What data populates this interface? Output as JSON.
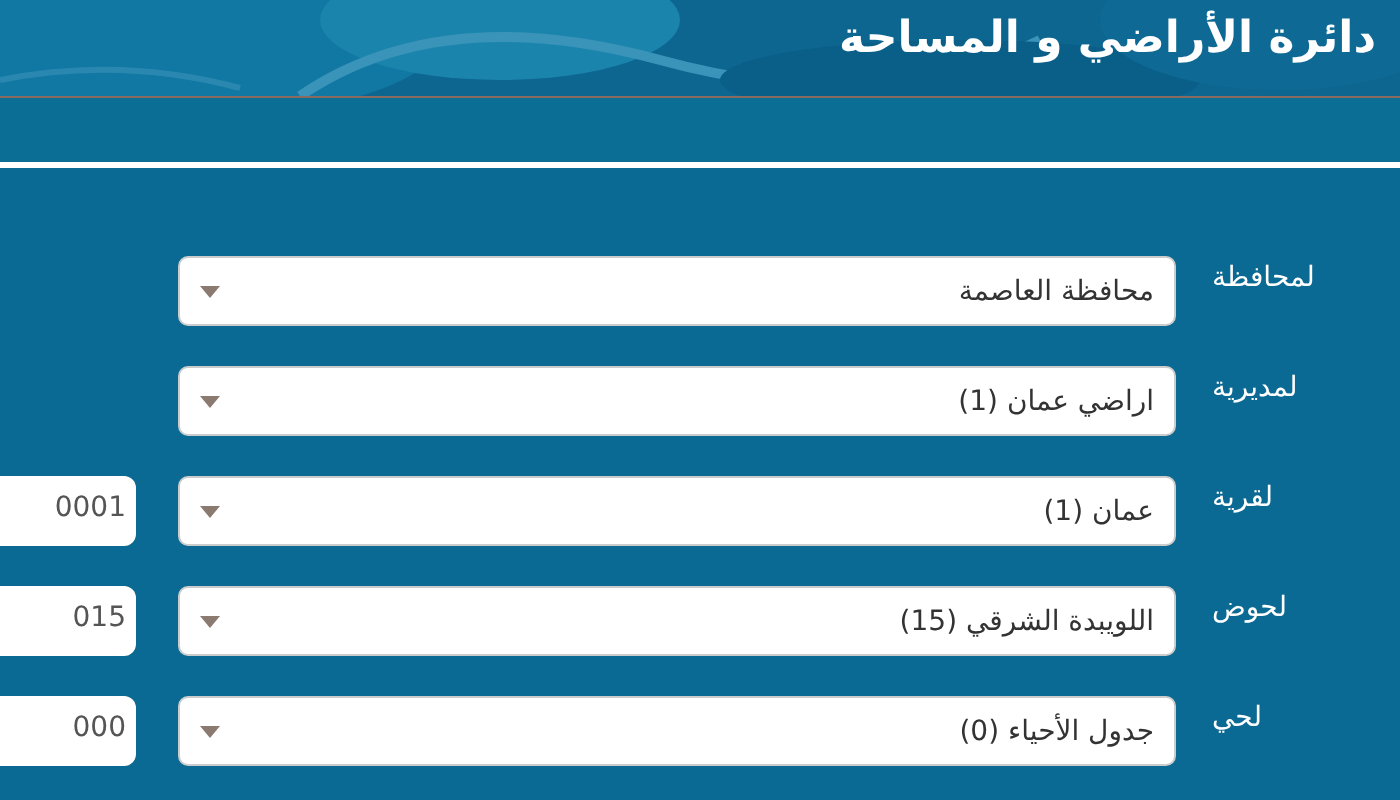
{
  "header": {
    "title": "دائرة الأراضي و المساحة"
  },
  "fields": [
    {
      "label": "لمحافظة",
      "value": "محافظة العاصمة"
    },
    {
      "label": "لمديرية",
      "value": "اراضي عمان (1)"
    },
    {
      "label": "لقرية",
      "value": "عمان (1)",
      "code": "0001"
    },
    {
      "label": "لحوض",
      "value": "اللويبدة الشرقي (15)",
      "code": "015"
    },
    {
      "label": "لحي",
      "value": "جدول الأحياء (0)",
      "code": "000"
    }
  ]
}
